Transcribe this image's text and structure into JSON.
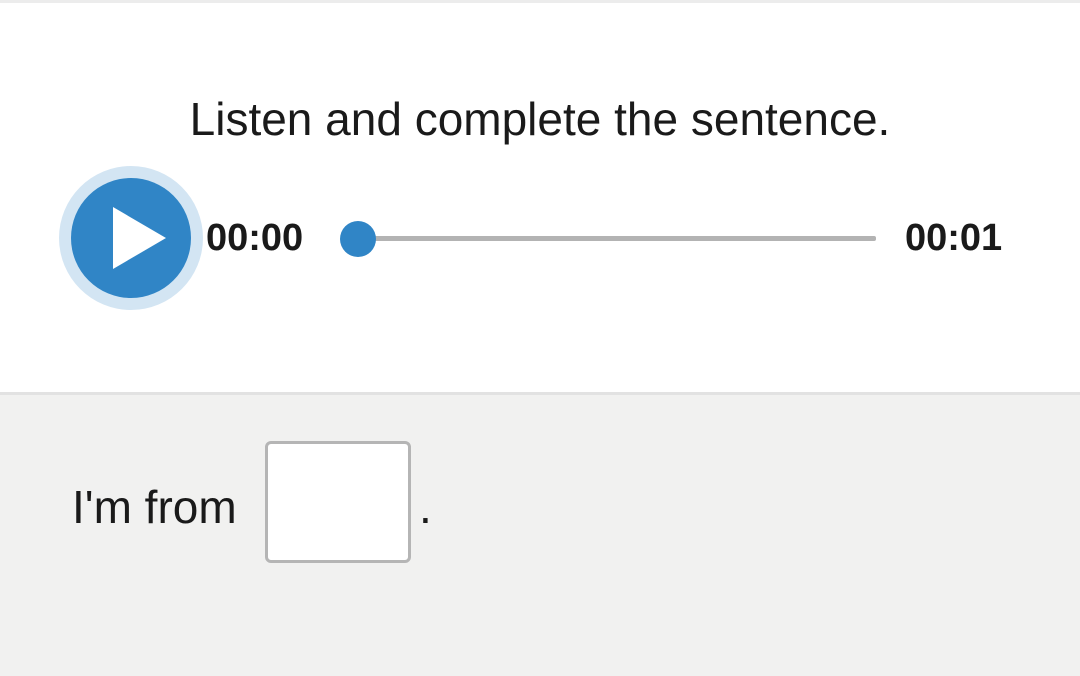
{
  "question": {
    "instruction": "Listen and complete the sentence."
  },
  "audio_player": {
    "current_time": "00:00",
    "total_time": "00:01",
    "progress_fraction": 0,
    "play_icon": "play-icon",
    "accent_color": "#3085c6",
    "halo_color": "#d3e5f3",
    "track_color": "#b3b3b3"
  },
  "answer": {
    "sentence_before": "I'm from",
    "blank_value": "",
    "sentence_after": "."
  },
  "colors": {
    "answer_background": "#f1f1f0",
    "text": "#1a1a1a"
  }
}
